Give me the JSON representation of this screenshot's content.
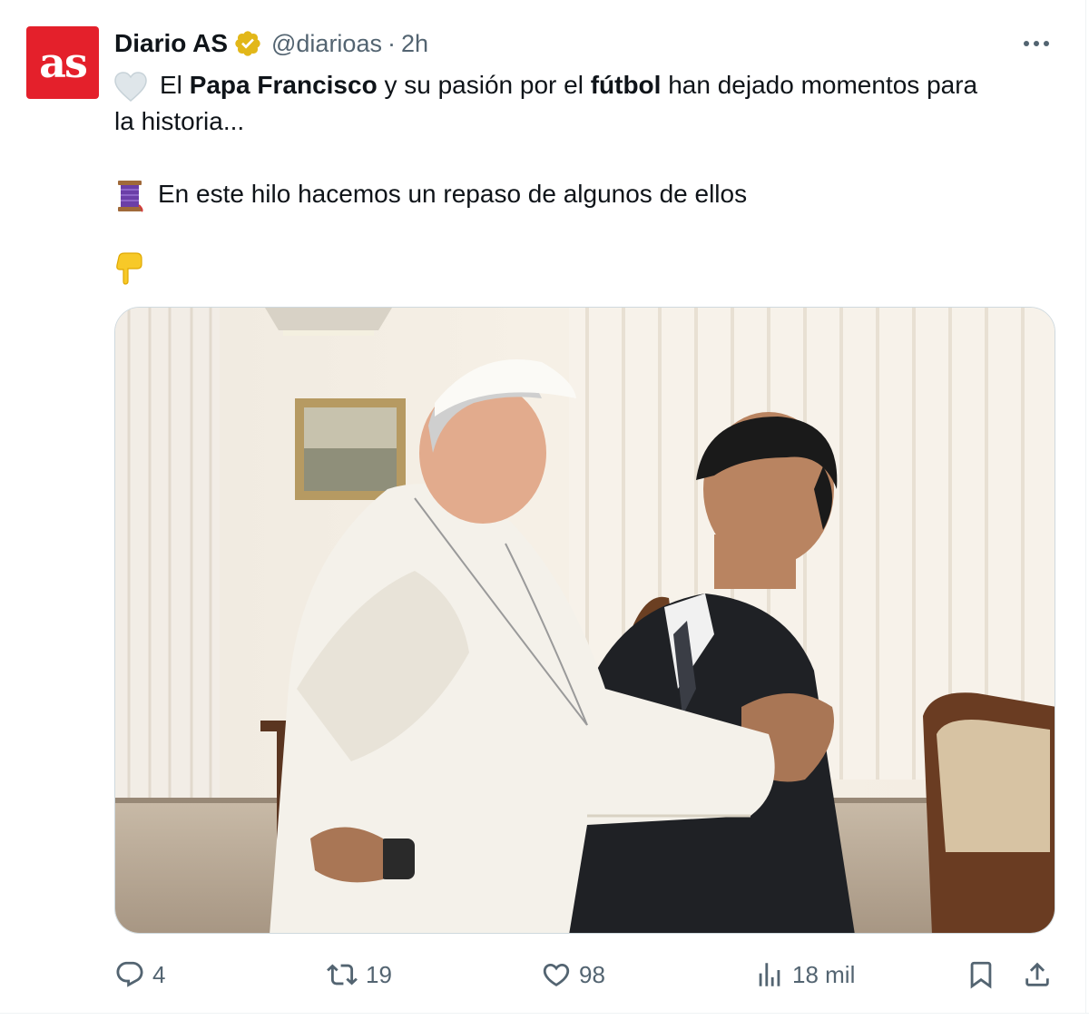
{
  "author": {
    "avatar_text": "as",
    "name": "Diario AS",
    "handle": "@diarioas",
    "separator": "·",
    "time": "2h",
    "verified_badge": "gold-check-badge-icon"
  },
  "tweet": {
    "line1_pre": "El ",
    "line1_bold1": "Papa Francisco",
    "line1_mid": " y su pasión por el ",
    "line1_bold2": "fútbol",
    "line1_post": " han dejado momentos para",
    "line2": "la historia...",
    "line3": "En este hilo hacemos un repaso de algunos de ellos",
    "emojis": [
      "white-heart-icon",
      "thread-spool-icon",
      "pointing-down-icon"
    ]
  },
  "media": {
    "description_icon": "photo"
  },
  "actions": {
    "replies": "4",
    "reposts": "19",
    "likes": "98",
    "views": "18 mil"
  },
  "colors": {
    "brand_red": "#e4202b",
    "verified_gold": "#e2b719",
    "secondary_text": "#536471"
  }
}
